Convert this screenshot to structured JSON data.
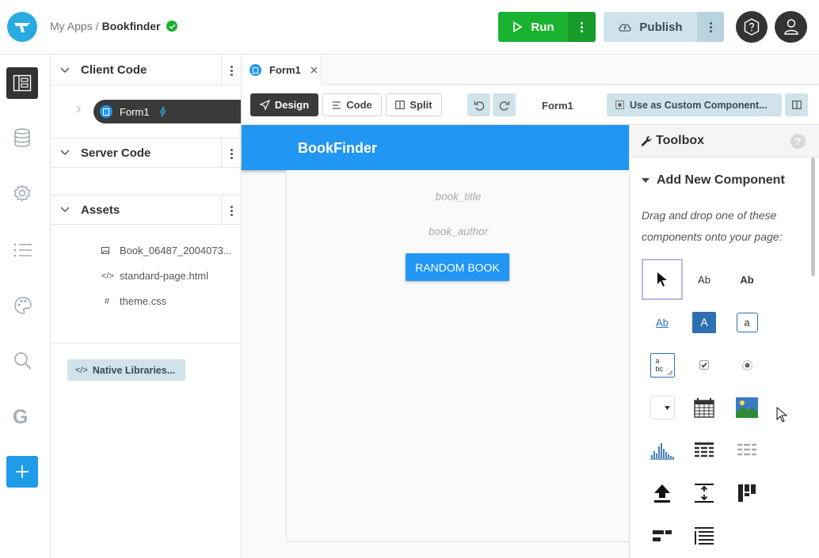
{
  "colors": {
    "accent": "#2196f3",
    "run_green": "#1ab231",
    "dark": "#333333",
    "publish_bg": "#d0e3eb",
    "lightning": "#29abe2"
  },
  "topbar": {
    "breadcrumb_root": "My Apps",
    "breadcrumb_sep": "/",
    "app_name": "Bookfinder",
    "run_label": "Run",
    "publish_label": "Publish",
    "icons": [
      "logo-icon",
      "check-circle-icon",
      "play-icon",
      "cloud-upload-icon",
      "question-icon",
      "user-icon"
    ]
  },
  "leftrail": {
    "items": [
      "app-browser-icon",
      "database-icon",
      "settings-icon",
      "list-icon",
      "palette-icon",
      "search-icon",
      "google-icon",
      "add-icon"
    ]
  },
  "sidebar": {
    "client_code": {
      "title": "Client Code",
      "items": [
        {
          "label": "Form1"
        }
      ]
    },
    "server_code": {
      "title": "Server Code"
    },
    "assets": {
      "title": "Assets",
      "items": [
        {
          "label": "Book_06487_2004073...",
          "icon": "image-icon"
        },
        {
          "label": "standard-page.html",
          "icon": "code-icon"
        },
        {
          "label": "theme.css",
          "icon": "hash-icon"
        }
      ]
    },
    "native_libraries": "Native Libraries..."
  },
  "tabs": [
    {
      "label": "Form1"
    }
  ],
  "toolbar": {
    "design": "Design",
    "code": "Code",
    "split": "Split",
    "form_name": "Form1",
    "custom_component": "Use as Custom Component..."
  },
  "canvas": {
    "title": "BookFinder",
    "book_title": "book_title",
    "book_author": "book_author",
    "button": "RANDOM BOOK"
  },
  "toolbox": {
    "title": "Toolbox",
    "section": "Add New Component",
    "hint": "Drag and drop one of these components onto your page:",
    "components": [
      "Ab",
      "Ab",
      "Ab",
      "A",
      "a",
      "a",
      "bc"
    ]
  }
}
